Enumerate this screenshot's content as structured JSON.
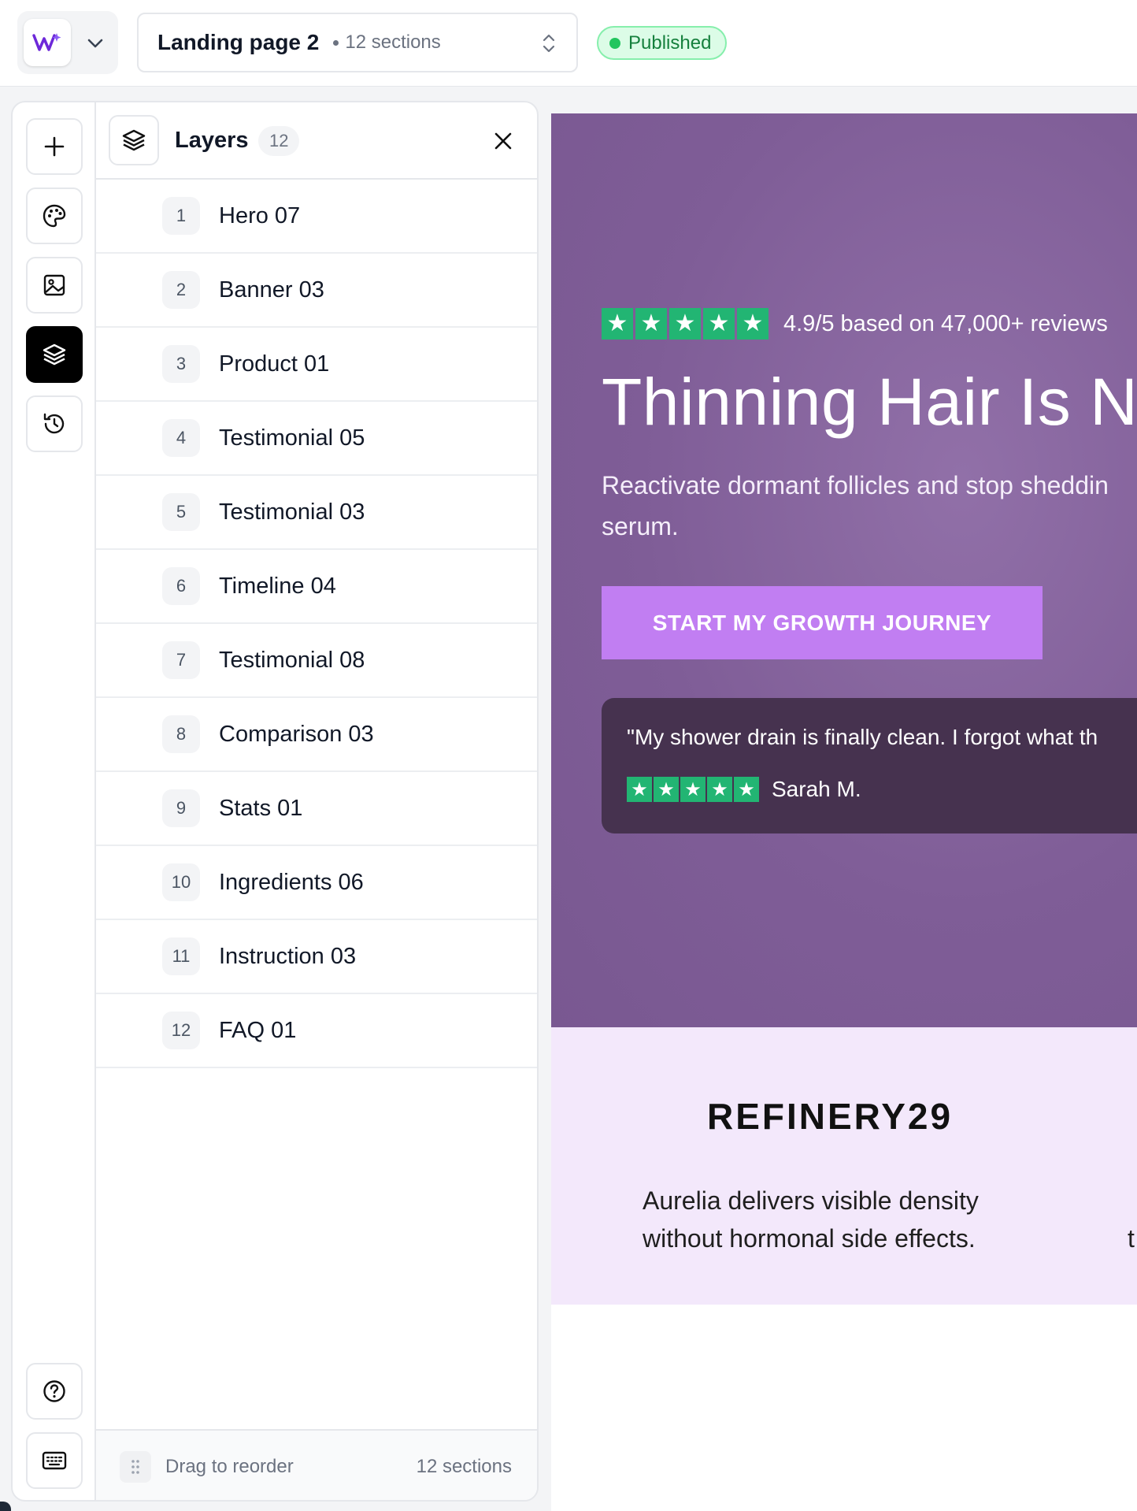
{
  "header": {
    "page_name": "Landing page 2",
    "section_count": "12 sections",
    "status": "Published",
    "colors": {
      "status_bg": "#dcfce7",
      "status_text": "#15803d",
      "brand": "#6d28d9"
    }
  },
  "rail": {
    "items": [
      {
        "name": "add-icon",
        "active": false
      },
      {
        "name": "palette-icon",
        "active": false
      },
      {
        "name": "image-icon",
        "active": false
      },
      {
        "name": "layers-icon",
        "active": true
      },
      {
        "name": "history-icon",
        "active": false
      }
    ],
    "bottom_items": [
      {
        "name": "help-icon"
      },
      {
        "name": "keyboard-icon"
      }
    ]
  },
  "layers": {
    "title": "Layers",
    "count": "12",
    "items": [
      {
        "num": "1",
        "label": "Hero 07"
      },
      {
        "num": "2",
        "label": "Banner 03"
      },
      {
        "num": "3",
        "label": "Product 01"
      },
      {
        "num": "4",
        "label": "Testimonial 05"
      },
      {
        "num": "5",
        "label": "Testimonial 03"
      },
      {
        "num": "6",
        "label": "Timeline 04"
      },
      {
        "num": "7",
        "label": "Testimonial 08"
      },
      {
        "num": "8",
        "label": "Comparison 03"
      },
      {
        "num": "9",
        "label": "Stats 01"
      },
      {
        "num": "10",
        "label": "Ingredients 06"
      },
      {
        "num": "11",
        "label": "Instruction 03"
      },
      {
        "num": "12",
        "label": "FAQ 01"
      }
    ],
    "footer": {
      "drag_label": "Drag to reorder",
      "count": "12 sections"
    }
  },
  "canvas": {
    "hero": {
      "rating": "4.9/5 based on 47,000+ reviews",
      "title": "Thinning Hair Is Ne",
      "subtitle_line1": "Reactivate dormant follicles and stop sheddin",
      "subtitle_line2": "serum.",
      "cta": "START MY GROWTH JOURNEY",
      "quote": "\"My shower drain is finally clean. I forgot what th",
      "quote_author": "Sarah M.",
      "colors": {
        "bg": "#7f5d97",
        "cta": "#c17ef2",
        "card": "#46324f",
        "star": "#22b573"
      }
    },
    "press": {
      "logo": "REFINERY29",
      "quote_line1": "Aurelia delivers visible density",
      "quote_line2": "without hormonal side effects.",
      "next_quote_fragment": "t",
      "bg": "#f3e8fb"
    }
  }
}
